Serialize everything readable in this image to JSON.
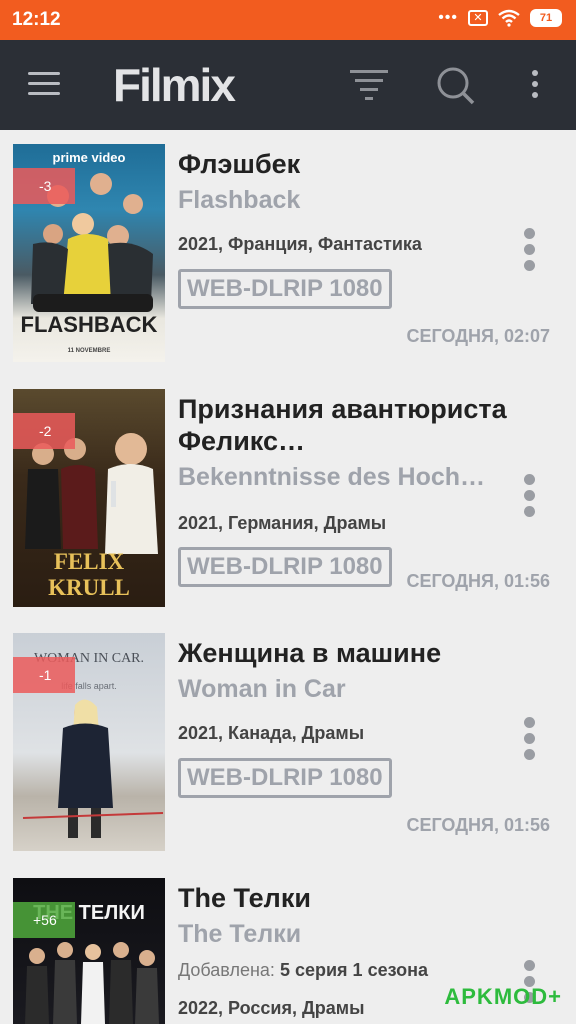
{
  "status": {
    "time": "12:12",
    "battery": "71"
  },
  "app": {
    "logo": "Filmix"
  },
  "items": [
    {
      "title": "Флэшбек",
      "original": "Flashback",
      "meta": "2021, Франция, Фантастика",
      "quality": "WEB-DLRIP 1080",
      "date": "СЕГОДНЯ, 02:07",
      "rating": "-3",
      "poster_top": "prime video",
      "poster_title": "FLASHBACK",
      "poster_bottom": "11 NOVEMBRE"
    },
    {
      "title": "Признания авантюриста Феликс…",
      "original": "Bekenntnisse des Hochst…",
      "meta": "2021, Германия, Драмы",
      "quality": "WEB-DLRIP 1080",
      "date": "СЕГОДНЯ, 01:56",
      "rating": "-2",
      "poster_title": "FELIX KRULL"
    },
    {
      "title": "Женщина в машине",
      "original": "Woman in Car",
      "meta": "2021, Канада, Драмы",
      "quality": "WEB-DLRIP 1080",
      "date": "СЕГОДНЯ, 01:56",
      "rating": "-1",
      "poster_title": "WOMAN IN CAR.",
      "poster_tagline": "life falls apart."
    },
    {
      "title": "The Телки",
      "original": "The Телки",
      "added_label": "Добавлена:",
      "added_value": "5 серия 1 сезона",
      "meta": "2022, Россия, Драмы",
      "rating": "+56",
      "poster_title": "THE ТЕЛКИ"
    }
  ],
  "watermark": "APKMOD+"
}
